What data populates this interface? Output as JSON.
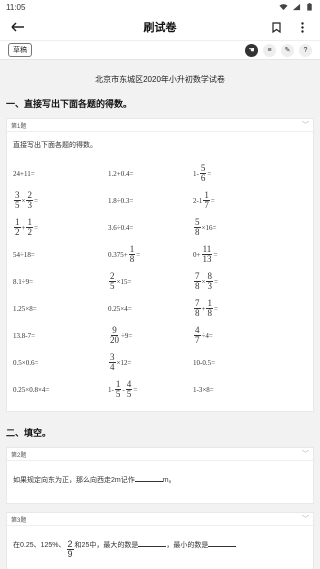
{
  "status": {
    "time": "11:05"
  },
  "header": {
    "title": "刷试卷"
  },
  "toolbar": {
    "draft_label": "草稿"
  },
  "paper_title": "北京市东城区2020年小升初数学试卷",
  "section1": {
    "title": "一、直接写出下面各题的得数。",
    "question_label": "第1题",
    "instruction": "直接写出下面各题的得数。",
    "rows": [
      [
        "24+11=",
        "1.2+0.4=",
        "1- 5/6 ="
      ],
      [
        "3/5 × 2/3 =",
        "1.8÷0.3=",
        "2- 1 1/7 ="
      ],
      [
        "1/2 + 1/2 =",
        "3.6÷0.4=",
        "5/8 ×16="
      ],
      [
        "54÷18=",
        "0.375+ 1/8 =",
        "0+ 11/13 ="
      ],
      [
        "8.1÷9=",
        "2/5 ×15=",
        "7/8 × 8/3 ="
      ],
      [
        "1.25×8=",
        "0.25×4=",
        "7/8 + 1/8 ="
      ],
      [
        "13.8-7=",
        "9/20 ÷9=",
        "4/7 ÷4="
      ],
      [
        "0.5×0.6=",
        "3/4 ×12=",
        "10-0.5="
      ],
      [
        "0.25×0.8×4=",
        "1- 1/5 - 4/5 =",
        "1-3×8="
      ]
    ]
  },
  "section2": {
    "title": "二、填空。",
    "q2_label": "第2题",
    "q2_text_before": "如果规定向东为正，那么向西走2m记作",
    "q2_text_after": "m。",
    "q3_label": "第3题",
    "q3_text": "在0.25、125%、 2/9 和25中，最大的数是",
    "q3_text_mid": "，最小的数是"
  }
}
